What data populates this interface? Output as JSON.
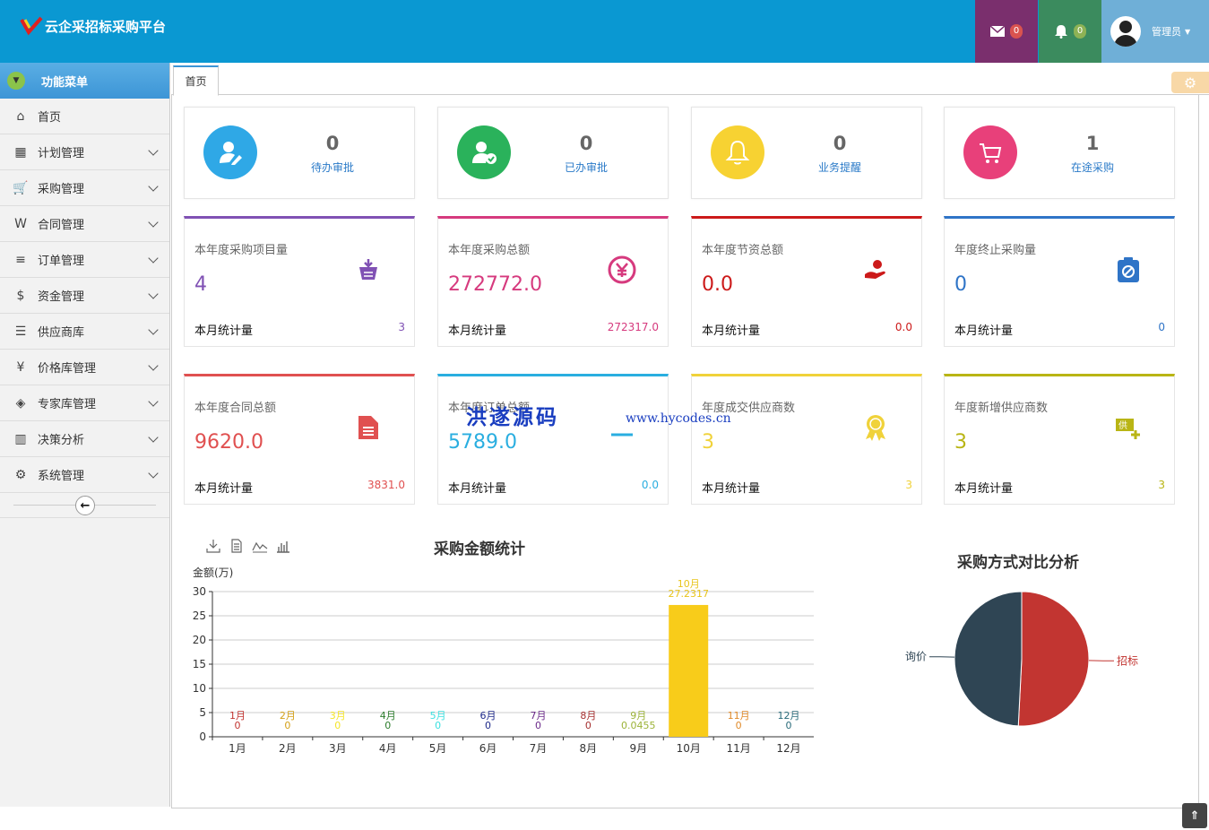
{
  "app": {
    "title": "云企采招标采购平台",
    "messages_count": "0",
    "notifications_count": "0",
    "user_name": "管理员"
  },
  "sidebar": {
    "header": "功能菜单",
    "items": [
      {
        "label": "首页",
        "icon": "home-icon",
        "glyph": "⌂"
      },
      {
        "label": "计划管理",
        "icon": "building-icon",
        "glyph": "▦"
      },
      {
        "label": "采购管理",
        "icon": "cart-icon",
        "glyph": "🛒"
      },
      {
        "label": "合同管理",
        "icon": "word-file-icon",
        "glyph": "W"
      },
      {
        "label": "订单管理",
        "icon": "list-icon",
        "glyph": "≡"
      },
      {
        "label": "资金管理",
        "icon": "money-file-icon",
        "glyph": "$"
      },
      {
        "label": "供应商库",
        "icon": "database-icon",
        "glyph": "☰"
      },
      {
        "label": "价格库管理",
        "icon": "yen-icon",
        "glyph": "¥"
      },
      {
        "label": "专家库管理",
        "icon": "cubes-icon",
        "glyph": "◈"
      },
      {
        "label": "决策分析",
        "icon": "bar-chart-icon",
        "glyph": "▥"
      },
      {
        "label": "系统管理",
        "icon": "gear-icon",
        "glyph": "⚙"
      }
    ]
  },
  "tabs": {
    "home": "首页"
  },
  "stats": [
    {
      "value": "0",
      "label": "待办审批",
      "color": "#2fa8e6",
      "icon": "user-edit-icon"
    },
    {
      "value": "0",
      "label": "已办审批",
      "color": "#2ab25b",
      "icon": "user-check-icon"
    },
    {
      "value": "0",
      "label": "业务提醒",
      "color": "#f7d232",
      "icon": "bell-icon"
    },
    {
      "value": "1",
      "label": "在途采购",
      "color": "#e8407a",
      "icon": "cart-icon"
    }
  ],
  "cards": [
    {
      "title": "本年度采购项目量",
      "value": "4",
      "month_label": "本月统计量",
      "month_value": "3",
      "color": "#8051b4",
      "icon": "basket-icon"
    },
    {
      "title": "本年度采购总额",
      "value": "272772.0",
      "month_label": "本月统计量",
      "month_value": "272317.0",
      "color": "#d63a7e",
      "icon": "yen-circle-icon"
    },
    {
      "title": "本年度节资总额",
      "value": "0.0",
      "month_label": "本月统计量",
      "month_value": "0.0",
      "color": "#cc1a1a",
      "icon": "money-hand-icon"
    },
    {
      "title": "年度终止采购量",
      "value": "0",
      "month_label": "本月统计量",
      "month_value": "0",
      "color": "#2f74c7",
      "icon": "ban-clipboard-icon"
    },
    {
      "title": "本年度合同总额",
      "value": "9620.0",
      "month_label": "本月统计量",
      "month_value": "3831.0",
      "color": "#e05050",
      "icon": "file-icon"
    },
    {
      "title": "本年度订单总额",
      "value": "5789.0",
      "month_label": "本月统计量",
      "month_value": "0.0",
      "color": "#2aaee0",
      "icon": "order-icon"
    },
    {
      "title": "年度成交供应商数",
      "value": "3",
      "month_label": "本月统计量",
      "month_value": "3",
      "color": "#f0d23a",
      "icon": "award-icon"
    },
    {
      "title": "年度新增供应商数",
      "value": "3",
      "month_label": "本月统计量",
      "month_value": "3",
      "color": "#b9b515",
      "icon": "supplier-add-icon"
    }
  ],
  "watermark": {
    "text": "洪遂源码",
    "url": "www.hycodes.cn"
  },
  "chart_data": [
    {
      "type": "bar",
      "title": "采购金额统计",
      "ylabel": "金额(万)",
      "ylim": [
        0,
        30
      ],
      "yticks": [
        0,
        5,
        10,
        15,
        20,
        25,
        30
      ],
      "categories": [
        "1月",
        "2月",
        "3月",
        "4月",
        "5月",
        "6月",
        "7月",
        "8月",
        "9月",
        "10月",
        "11月",
        "12月"
      ],
      "values": [
        0,
        0,
        0,
        0,
        0,
        0,
        0,
        0,
        0.0455,
        27.2317,
        0,
        0
      ],
      "value_labels": [
        "0",
        "0",
        "0",
        "0",
        "0",
        "0",
        "0",
        "0",
        "0.0455",
        "27.2317",
        "0",
        "0"
      ],
      "label_colors": [
        "#c23531",
        "#d4a017",
        "#f5e52a",
        "#2d7d2d",
        "#3de0e0",
        "#1f2a8a",
        "#6b2a8a",
        "#a53030",
        "#9cb338",
        "#e8c41a",
        "#e08a2a",
        "#2a6b7a"
      ],
      "bar_color": "#f8cc1a",
      "grid": true
    },
    {
      "type": "pie",
      "title": "采购方式对比分析",
      "slices": [
        {
          "name": "招标",
          "value": 50.8,
          "color": "#c23531"
        },
        {
          "name": "询价",
          "value": 49.2,
          "color": "#2f4554"
        }
      ]
    }
  ]
}
